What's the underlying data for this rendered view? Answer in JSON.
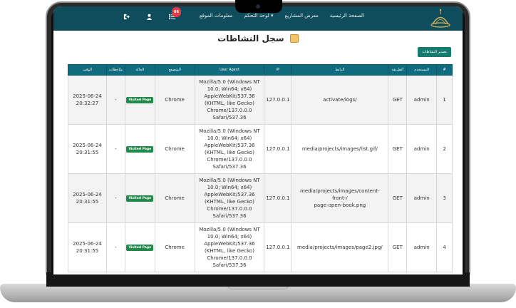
{
  "nav": {
    "links": [
      "الصفحة الرئيسية",
      "معرض المشاريع",
      "لوحة التحكم ▾",
      "معلومات الموقع"
    ],
    "notification_count": "66",
    "icons": [
      "logout-icon",
      "user-icon",
      "list-icon"
    ]
  },
  "page": {
    "title": "سجل النشاطات",
    "export_label": "تصدير النشاطات"
  },
  "table": {
    "headers": [
      "#",
      "المستخدم",
      "الطريقة",
      "الرابط",
      "IP",
      "User Agent",
      "المتصفح",
      "الحالة",
      "ملاحظات",
      "الوقت"
    ],
    "rows": [
      {
        "num": "1",
        "user": "admin",
        "method": "GET",
        "path": "activate/logs/",
        "ip": "127.0.0.1",
        "ua": [
          "Mozilla/5.0 (Windows NT",
          "10.0; Win64; x64)",
          "AppleWebKit/537.36",
          "(KHTML, like Gecko)",
          "Chrome/137.0.0.0",
          "Safari/537.36"
        ],
        "browser": "Chrome",
        "status": "Visited Page",
        "notes": "-",
        "time": [
          "2025-06-24",
          "20:32:27"
        ]
      },
      {
        "num": "2",
        "user": "admin",
        "method": "GET",
        "path": "media/projects/images/list.gif/",
        "ip": "127.0.0.1",
        "ua": [
          "Mozilla/5.0 (Windows NT",
          "10.0; Win64; x64)",
          "AppleWebKit/537.36",
          "(KHTML, like Gecko)",
          "Chrome/137.0.0.0",
          "Safari/537.36"
        ],
        "browser": "Chrome",
        "status": "Visited Page",
        "notes": "-",
        "time": [
          "2025-06-24",
          "20:31:55"
        ]
      },
      {
        "num": "3",
        "user": "admin",
        "method": "GET",
        "path": "media/projects/images/content-front-/",
        "path2": "page-open-book.png",
        "ip": "127.0.0.1",
        "ua": [
          "Mozilla/5.0 (Windows NT",
          "10.0; Win64; x64)",
          "AppleWebKit/537.36",
          "(KHTML, like Gecko)",
          "Chrome/137.0.0.0",
          "Safari/537.36"
        ],
        "browser": "Chrome",
        "status": "Visited Page",
        "notes": "-",
        "time": [
          "2025-06-24",
          "20:31:55"
        ]
      },
      {
        "num": "4",
        "user": "admin",
        "method": "GET",
        "path": "media/projects/images/page2.jpg/",
        "ip": "127.0.0.1",
        "ua": [
          "Mozilla/5.0 (Windows NT",
          "10.0; Win64; x64)",
          "AppleWebKit/537.36",
          "(KHTML, like Gecko)",
          "Chrome/137.0.0.0",
          "Safari/537.36"
        ],
        "browser": "Chrome",
        "status": "Visited Page",
        "notes": "-",
        "time": [
          "2025-06-24",
          "20:31:55"
        ]
      }
    ]
  },
  "colors": {
    "navbar": "#0f4c5c",
    "table_header": "#0f6b7e",
    "status_badge": "#1f8a4a",
    "notification": "#e53946"
  }
}
